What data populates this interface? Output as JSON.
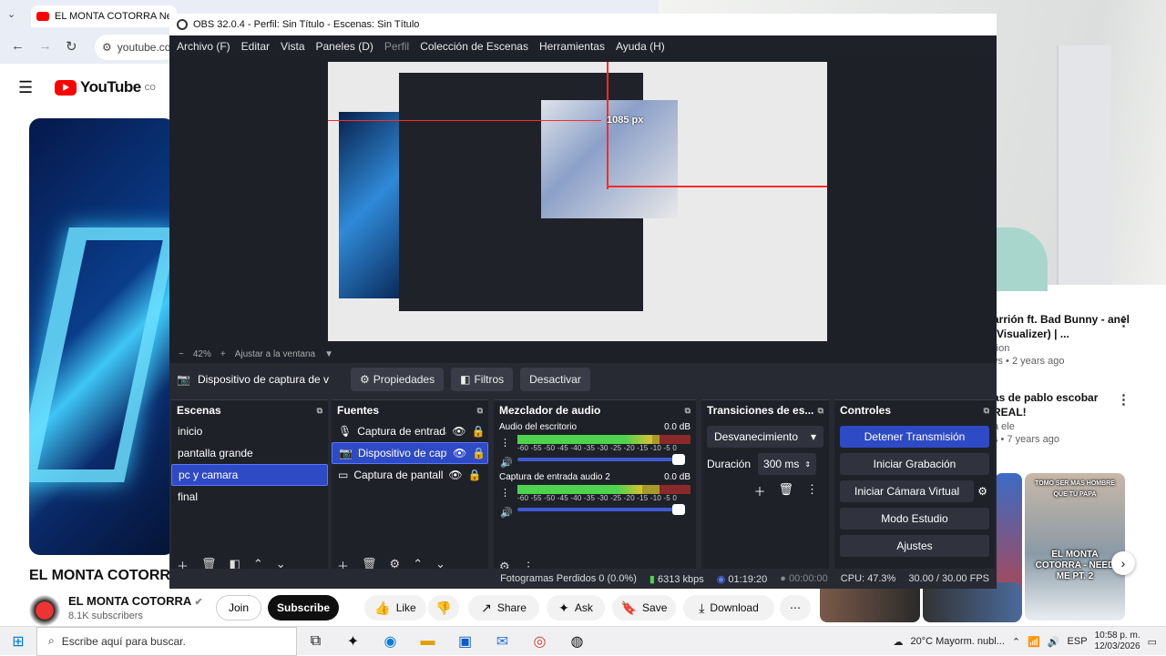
{
  "browser": {
    "tab_title": "EL MONTA COTORRA Need M",
    "omnibox": "youtube.co"
  },
  "youtube": {
    "logo": "YouTube",
    "logo_sup": "CO",
    "video_title": "EL MONTA COTORRA",
    "channel": "EL MONTA COTORRA",
    "subs": "8.1K subscribers",
    "join": "Join",
    "subscribe": "Subscribe",
    "like": "Like",
    "share": "Share",
    "ask": "Ask",
    "save": "Save",
    "download": "Download",
    "recs": [
      {
        "title": "arrión ft. Bad Bunny - anel (Visualizer) | ...",
        "channel": "rion",
        "meta": "vs • 2 years ago"
      },
      {
        "title": "as de pablo escobar REAL!",
        "channel": "a ele",
        "meta": "s • 7 years ago"
      }
    ],
    "short_caption": "EL MONTA COTORRA - NEED ME PT. 2",
    "short_top": "TOMO SER MAS HOMBRE QUE TU PAPA"
  },
  "obs": {
    "title": "OBS 32.0.4 - Perfil: Sin Título - Escenas: Sin Título",
    "menu": [
      "Archivo (F)",
      "Editar",
      "Vista",
      "Paneles (D)",
      "Perfil",
      "Colección de Escenas",
      "Herramientas",
      "Ayuda (H)"
    ],
    "px_label": "1085 px",
    "zoom": "42%",
    "fit": "Ajustar a la ventana",
    "source_label": "Dispositivo de captura de v",
    "props": "Propiedades",
    "filters": "Filtros",
    "deactivate": "Desactivar",
    "scenes_title": "Escenas",
    "scenes": [
      "inicio",
      "pantalla grande",
      "pc y camara",
      "final"
    ],
    "sources_title": "Fuentes",
    "sources": [
      "Captura de entrada",
      "Dispositivo de capti",
      "Captura de pantalla"
    ],
    "mixer_title": "Mezclador de audio",
    "channels": [
      {
        "name": "Audio del escritorio",
        "db": "0.0 dB",
        "level": 0.78
      },
      {
        "name": "Captura de entrada audio 2",
        "db": "0.0 dB",
        "level": 0.72
      }
    ],
    "ticks": "-60 -55 -50 -45 -40 -35 -30 -25 -20 -15 -10 -5 0",
    "transitions_title": "Transiciones de es...",
    "transition": "Desvanecimiento",
    "duration_label": "Duración",
    "duration": "300 ms",
    "controls_title": "Controles",
    "controls": [
      "Detener Transmisión",
      "Iniciar Grabación",
      "Iniciar Cámara Virtual",
      "Modo Estudio",
      "Ajustes"
    ],
    "status": {
      "dropped": "Fotogramas Perdidos 0 (0.0%)",
      "kbps": "6313 kbps",
      "live": "01:19:20",
      "rec": "00:00:00",
      "cpu": "CPU: 47.3%",
      "fps": "30.00 / 30.00 FPS"
    }
  },
  "taskbar": {
    "search": "Escribe aquí para buscar.",
    "weather": "20°C  Mayorm. nubl...",
    "lang": "ESP",
    "time": "10:58 p. m.",
    "date": "12/03/2026"
  }
}
